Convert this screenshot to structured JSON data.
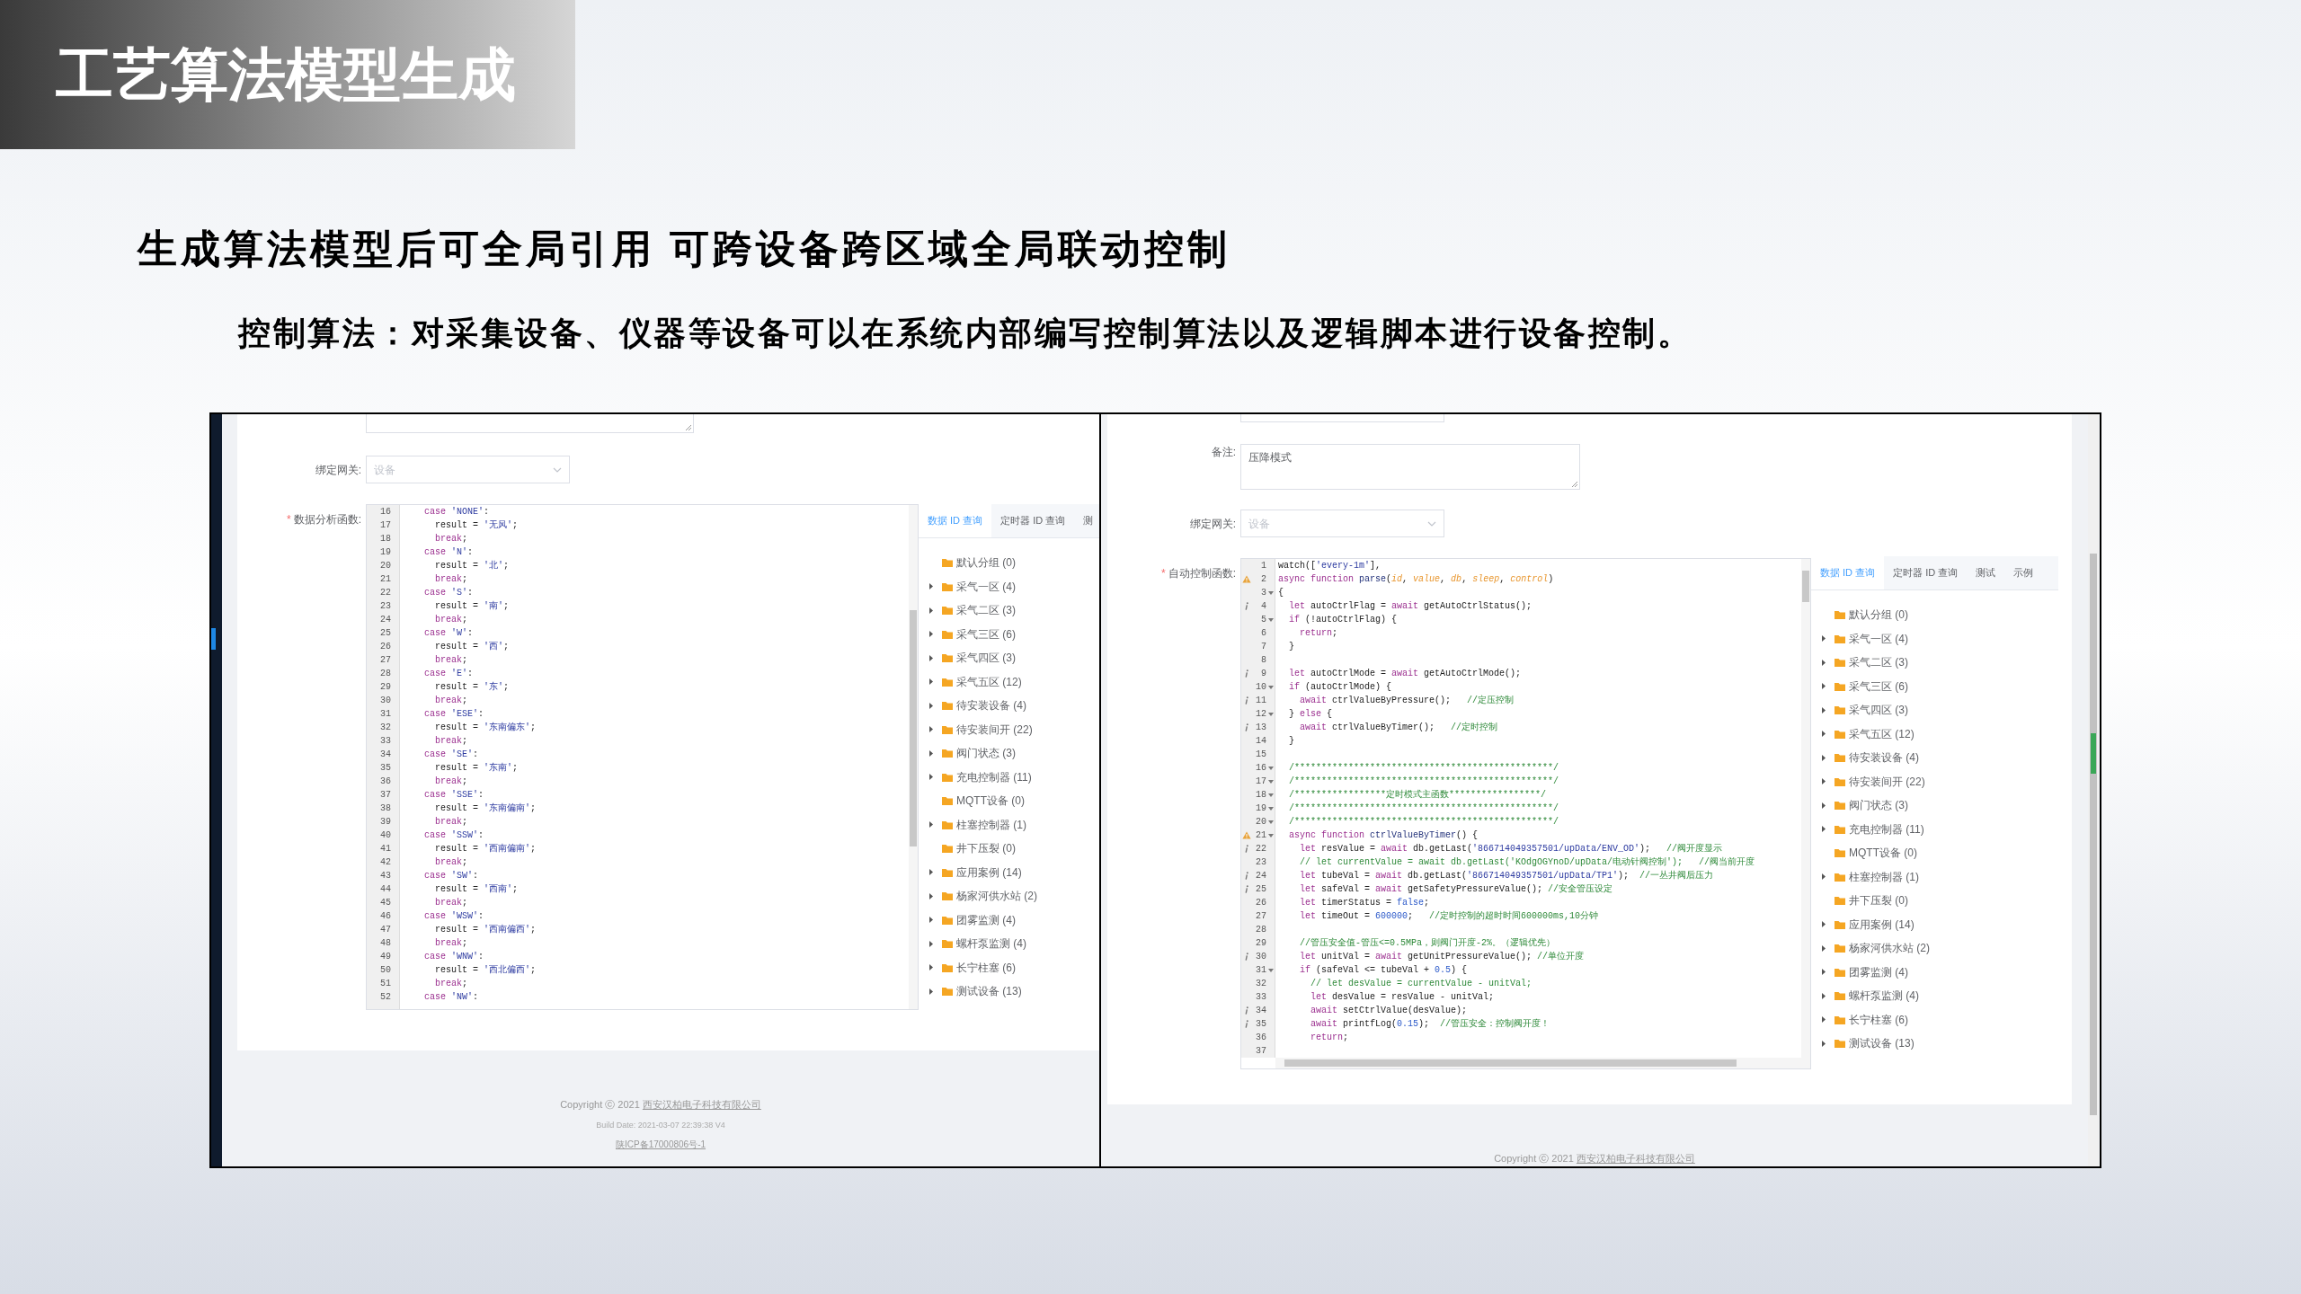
{
  "slide": {
    "title": "工艺算法模型生成",
    "subtitle": "生成算法模型后可全局引用 可跨设备跨区域全局联动控制",
    "description": "控制算法：对采集设备、仪器等设备可以在系统内部编写控制算法以及逻辑脚本进行设备控制。"
  },
  "screens": [
    {
      "fields": [
        {
          "kind": "stub_textarea"
        },
        {
          "kind": "select",
          "label": "绑定网关:",
          "placeholder": "设备"
        }
      ],
      "code_label": "数据分析函数:",
      "required_mark": "*",
      "code_lines": [
        {
          "n": "16",
          "t": [
            {
              "kind": "k",
              "text": "    case "
            },
            {
              "kind": "s",
              "text": "'NONE'"
            },
            {
              "kind": "p",
              "text": ":"
            }
          ]
        },
        {
          "n": "17",
          "t": [
            {
              "kind": "p",
              "text": "      result = "
            },
            {
              "kind": "s",
              "text": "'无风'"
            },
            {
              "kind": "p",
              "text": ";"
            }
          ]
        },
        {
          "n": "18",
          "t": [
            {
              "kind": "k",
              "text": "      break"
            },
            {
              "kind": "p",
              "text": ";"
            }
          ]
        },
        {
          "n": "19",
          "t": [
            {
              "kind": "k",
              "text": "    case "
            },
            {
              "kind": "s",
              "text": "'N'"
            },
            {
              "kind": "p",
              "text": ":"
            }
          ]
        },
        {
          "n": "20",
          "t": [
            {
              "kind": "p",
              "text": "      result = "
            },
            {
              "kind": "s",
              "text": "'北'"
            },
            {
              "kind": "p",
              "text": ";"
            }
          ]
        },
        {
          "n": "21",
          "t": [
            {
              "kind": "k",
              "text": "      break"
            },
            {
              "kind": "p",
              "text": ";"
            }
          ]
        },
        {
          "n": "22",
          "t": [
            {
              "kind": "k",
              "text": "    case "
            },
            {
              "kind": "s",
              "text": "'S'"
            },
            {
              "kind": "p",
              "text": ":"
            }
          ]
        },
        {
          "n": "23",
          "t": [
            {
              "kind": "p",
              "text": "      result = "
            },
            {
              "kind": "s",
              "text": "'南'"
            },
            {
              "kind": "p",
              "text": ";"
            }
          ]
        },
        {
          "n": "24",
          "t": [
            {
              "kind": "k",
              "text": "      break"
            },
            {
              "kind": "p",
              "text": ";"
            }
          ]
        },
        {
          "n": "25",
          "t": [
            {
              "kind": "k",
              "text": "    case "
            },
            {
              "kind": "s",
              "text": "'W'"
            },
            {
              "kind": "p",
              "text": ":"
            }
          ]
        },
        {
          "n": "26",
          "t": [
            {
              "kind": "p",
              "text": "      result = "
            },
            {
              "kind": "s",
              "text": "'西'"
            },
            {
              "kind": "p",
              "text": ";"
            }
          ]
        },
        {
          "n": "27",
          "t": [
            {
              "kind": "k",
              "text": "      break"
            },
            {
              "kind": "p",
              "text": ";"
            }
          ]
        },
        {
          "n": "28",
          "t": [
            {
              "kind": "k",
              "text": "    case "
            },
            {
              "kind": "s",
              "text": "'E'"
            },
            {
              "kind": "p",
              "text": ":"
            }
          ]
        },
        {
          "n": "29",
          "t": [
            {
              "kind": "p",
              "text": "      result = "
            },
            {
              "kind": "s",
              "text": "'东'"
            },
            {
              "kind": "p",
              "text": ";"
            }
          ]
        },
        {
          "n": "30",
          "t": [
            {
              "kind": "k",
              "text": "      break"
            },
            {
              "kind": "p",
              "text": ";"
            }
          ]
        },
        {
          "n": "31",
          "t": [
            {
              "kind": "k",
              "text": "    case "
            },
            {
              "kind": "s",
              "text": "'ESE'"
            },
            {
              "kind": "p",
              "text": ":"
            }
          ]
        },
        {
          "n": "32",
          "t": [
            {
              "kind": "p",
              "text": "      result = "
            },
            {
              "kind": "s",
              "text": "'东南偏东'"
            },
            {
              "kind": "p",
              "text": ";"
            }
          ]
        },
        {
          "n": "33",
          "t": [
            {
              "kind": "k",
              "text": "      break"
            },
            {
              "kind": "p",
              "text": ";"
            }
          ]
        },
        {
          "n": "34",
          "t": [
            {
              "kind": "k",
              "text": "    case "
            },
            {
              "kind": "s",
              "text": "'SE'"
            },
            {
              "kind": "p",
              "text": ":"
            }
          ]
        },
        {
          "n": "35",
          "t": [
            {
              "kind": "p",
              "text": "      result = "
            },
            {
              "kind": "s",
              "text": "'东南'"
            },
            {
              "kind": "p",
              "text": ";"
            }
          ]
        },
        {
          "n": "36",
          "t": [
            {
              "kind": "k",
              "text": "      break"
            },
            {
              "kind": "p",
              "text": ";"
            }
          ]
        },
        {
          "n": "37",
          "t": [
            {
              "kind": "k",
              "text": "    case "
            },
            {
              "kind": "s",
              "text": "'SSE'"
            },
            {
              "kind": "p",
              "text": ":"
            }
          ]
        },
        {
          "n": "38",
          "t": [
            {
              "kind": "p",
              "text": "      result = "
            },
            {
              "kind": "s",
              "text": "'东南偏南'"
            },
            {
              "kind": "p",
              "text": ";"
            }
          ]
        },
        {
          "n": "39",
          "t": [
            {
              "kind": "k",
              "text": "      break"
            },
            {
              "kind": "p",
              "text": ";"
            }
          ]
        },
        {
          "n": "40",
          "t": [
            {
              "kind": "k",
              "text": "    case "
            },
            {
              "kind": "s",
              "text": "'SSW'"
            },
            {
              "kind": "p",
              "text": ":"
            }
          ]
        },
        {
          "n": "41",
          "t": [
            {
              "kind": "p",
              "text": "      result = "
            },
            {
              "kind": "s",
              "text": "'西南偏南'"
            },
            {
              "kind": "p",
              "text": ";"
            }
          ]
        },
        {
          "n": "42",
          "t": [
            {
              "kind": "k",
              "text": "      break"
            },
            {
              "kind": "p",
              "text": ";"
            }
          ]
        },
        {
          "n": "43",
          "t": [
            {
              "kind": "k",
              "text": "    case "
            },
            {
              "kind": "s",
              "text": "'SW'"
            },
            {
              "kind": "p",
              "text": ":"
            }
          ]
        },
        {
          "n": "44",
          "t": [
            {
              "kind": "p",
              "text": "      result = "
            },
            {
              "kind": "s",
              "text": "'西南'"
            },
            {
              "kind": "p",
              "text": ";"
            }
          ]
        },
        {
          "n": "45",
          "t": [
            {
              "kind": "k",
              "text": "      break"
            },
            {
              "kind": "p",
              "text": ";"
            }
          ]
        },
        {
          "n": "46",
          "t": [
            {
              "kind": "k",
              "text": "    case "
            },
            {
              "kind": "s",
              "text": "'WSW'"
            },
            {
              "kind": "p",
              "text": ":"
            }
          ]
        },
        {
          "n": "47",
          "t": [
            {
              "kind": "p",
              "text": "      result = "
            },
            {
              "kind": "s",
              "text": "'西南偏西'"
            },
            {
              "kind": "p",
              "text": ";"
            }
          ]
        },
        {
          "n": "48",
          "t": [
            {
              "kind": "k",
              "text": "      break"
            },
            {
              "kind": "p",
              "text": ";"
            }
          ]
        },
        {
          "n": "49",
          "t": [
            {
              "kind": "k",
              "text": "    case "
            },
            {
              "kind": "s",
              "text": "'WNW'"
            },
            {
              "kind": "p",
              "text": ":"
            }
          ]
        },
        {
          "n": "50",
          "t": [
            {
              "kind": "p",
              "text": "      result = "
            },
            {
              "kind": "s",
              "text": "'西北偏西'"
            },
            {
              "kind": "p",
              "text": ";"
            }
          ]
        },
        {
          "n": "51",
          "t": [
            {
              "kind": "k",
              "text": "      break"
            },
            {
              "kind": "p",
              "text": ";"
            }
          ]
        },
        {
          "n": "52",
          "t": [
            {
              "kind": "k",
              "text": "    case "
            },
            {
              "kind": "s",
              "text": "'NW'"
            },
            {
              "kind": "p",
              "text": ":"
            }
          ]
        }
      ],
      "tree_tabs": [
        {
          "label": "数据 ID 查询",
          "selected": true
        },
        {
          "label": "定时器 ID 查询",
          "selected": false
        },
        {
          "label": "测",
          "selected": false
        }
      ],
      "tree_items": [
        {
          "label": "默认分组 (0)",
          "expandable": false
        },
        {
          "label": "采气一区 (4)",
          "expandable": true
        },
        {
          "label": "采气二区 (3)",
          "expandable": true
        },
        {
          "label": "采气三区 (6)",
          "expandable": true
        },
        {
          "label": "采气四区 (3)",
          "expandable": true
        },
        {
          "label": "采气五区 (12)",
          "expandable": true
        },
        {
          "label": "待安装设备 (4)",
          "expandable": true
        },
        {
          "label": "待安装间开 (22)",
          "expandable": true
        },
        {
          "label": "阀门状态 (3)",
          "expandable": true
        },
        {
          "label": "充电控制器 (11)",
          "expandable": true
        },
        {
          "label": "MQTT设备 (0)",
          "expandable": false
        },
        {
          "label": "柱塞控制器 (1)",
          "expandable": true
        },
        {
          "label": "井下压裂 (0)",
          "expandable": false
        },
        {
          "label": "应用案例 (14)",
          "expandable": true
        },
        {
          "label": "杨家河供水站 (2)",
          "expandable": true
        },
        {
          "label": "团雾监测 (4)",
          "expandable": true
        },
        {
          "label": "螺杆泵监测 (4)",
          "expandable": true
        },
        {
          "label": "长宁柱塞 (6)",
          "expandable": true
        },
        {
          "label": "测试设备 (13)",
          "expandable": true
        }
      ],
      "footer": {
        "copyright": "Copyright ⓒ 2021",
        "company": "西安汉柏电子科技有限公司",
        "build": "Build Date: 2021-03-07 22:39:38 V4",
        "icp": "陕ICP备17000806号-1"
      }
    },
    {
      "fields": [
        {
          "kind": "stub_input"
        },
        {
          "kind": "textarea",
          "label": "备注:",
          "value": "压降模式"
        },
        {
          "kind": "select",
          "label": "绑定网关:",
          "placeholder": "设备"
        }
      ],
      "code_label": "自动控制函数:",
      "required_mark": "*",
      "code_lines": [
        {
          "n": "1",
          "fold": false,
          "t": [
            {
              "kind": "p",
              "text": "watch(["
            },
            {
              "kind": "s",
              "text": "'every-1m'"
            },
            {
              "kind": "p",
              "text": "],"
            }
          ]
        },
        {
          "n": "2",
          "fold": false,
          "kind": "warn",
          "t": [
            {
              "kind": "k",
              "text": "async function "
            },
            {
              "kind": "d",
              "text": "parse"
            },
            {
              "kind": "p",
              "text": "("
            },
            {
              "kind": "v",
              "text": "id"
            },
            {
              "kind": "p",
              "text": ", "
            },
            {
              "kind": "v",
              "text": "value"
            },
            {
              "kind": "p",
              "text": ", "
            },
            {
              "kind": "v",
              "text": "db"
            },
            {
              "kind": "p",
              "text": ", "
            },
            {
              "kind": "v",
              "text": "sleep"
            },
            {
              "kind": "p",
              "text": ", "
            },
            {
              "kind": "v",
              "text": "control"
            },
            {
              "kind": "p",
              "text": ")"
            }
          ]
        },
        {
          "n": "3",
          "fold": true,
          "t": [
            {
              "kind": "p",
              "text": "{"
            }
          ]
        },
        {
          "n": "4",
          "fold": false,
          "kind": "info",
          "t": [
            {
              "kind": "k",
              "text": "  let "
            },
            {
              "kind": "p",
              "text": "autoCtrlFlag = "
            },
            {
              "kind": "k",
              "text": "await "
            },
            {
              "kind": "p",
              "text": "getAutoCtrlStatus();"
            }
          ]
        },
        {
          "n": "5",
          "fold": true,
          "t": [
            {
              "kind": "k",
              "text": "  if "
            },
            {
              "kind": "p",
              "text": "(!autoCtrlFlag) {"
            }
          ]
        },
        {
          "n": "6",
          "fold": false,
          "t": [
            {
              "kind": "k",
              "text": "    return"
            },
            {
              "kind": "p",
              "text": ";"
            }
          ]
        },
        {
          "n": "7",
          "fold": false,
          "t": [
            {
              "kind": "p",
              "text": "  }"
            }
          ]
        },
        {
          "n": "8",
          "fold": false
        },
        {
          "n": "9",
          "fold": false,
          "kind": "info",
          "t": [
            {
              "kind": "k",
              "text": "  let "
            },
            {
              "kind": "p",
              "text": "autoCtrlMode = "
            },
            {
              "kind": "k",
              "text": "await "
            },
            {
              "kind": "p",
              "text": "getAutoCtrlMode();"
            }
          ]
        },
        {
          "n": "10",
          "fold": true,
          "t": [
            {
              "kind": "k",
              "text": "  if "
            },
            {
              "kind": "p",
              "text": "(autoCtrlMode) {"
            }
          ]
        },
        {
          "n": "11",
          "fold": false,
          "kind": "info",
          "t": [
            {
              "kind": "k",
              "text": "    await "
            },
            {
              "kind": "p",
              "text": "ctrlValueByPressure();   "
            },
            {
              "kind": "c",
              "text": "//定压控制"
            }
          ]
        },
        {
          "n": "12",
          "fold": true,
          "t": [
            {
              "kind": "p",
              "text": "  } "
            },
            {
              "kind": "k",
              "text": "else "
            },
            {
              "kind": "p",
              "text": "{"
            }
          ]
        },
        {
          "n": "13",
          "fold": false,
          "kind": "info",
          "t": [
            {
              "kind": "k",
              "text": "    await "
            },
            {
              "kind": "p",
              "text": "ctrlValueByTimer();   "
            },
            {
              "kind": "c",
              "text": "//定时控制"
            }
          ]
        },
        {
          "n": "14",
          "fold": false,
          "t": [
            {
              "kind": "p",
              "text": "  }"
            }
          ]
        },
        {
          "n": "15",
          "fold": false
        },
        {
          "n": "16",
          "fold": true,
          "t": [
            {
              "kind": "c",
              "text": "  /************************************************/"
            }
          ]
        },
        {
          "n": "17",
          "fold": true,
          "t": [
            {
              "kind": "c",
              "text": "  /************************************************/"
            }
          ]
        },
        {
          "n": "18",
          "fold": true,
          "t": [
            {
              "kind": "c",
              "text": "  /*****************定时模式主函数*****************/"
            }
          ]
        },
        {
          "n": "19",
          "fold": true,
          "t": [
            {
              "kind": "c",
              "text": "  /************************************************/"
            }
          ]
        },
        {
          "n": "20",
          "fold": true,
          "t": [
            {
              "kind": "c",
              "text": "  /************************************************/"
            }
          ]
        },
        {
          "n": "21",
          "fold": true,
          "kind": "warn",
          "t": [
            {
              "kind": "k",
              "text": "  async function "
            },
            {
              "kind": "d",
              "text": "ctrlValueByTimer"
            },
            {
              "kind": "p",
              "text": "() {"
            }
          ]
        },
        {
          "n": "22",
          "fold": false,
          "kind": "info",
          "t": [
            {
              "kind": "k",
              "text": "    let "
            },
            {
              "kind": "p",
              "text": "resValue = "
            },
            {
              "kind": "k",
              "text": "await "
            },
            {
              "kind": "p",
              "text": "db.getLast("
            },
            {
              "kind": "s",
              "text": "'866714049357501/upData/ENV_OD'"
            },
            {
              "kind": "p",
              "text": ");   "
            },
            {
              "kind": "c",
              "text": "//阀开度显示"
            }
          ]
        },
        {
          "n": "23",
          "fold": false,
          "t": [
            {
              "kind": "c",
              "text": "    // let currentValue = await db.getLast('KOdgOGYnoD/upData/电动针阀控制');   //阀当前开度"
            }
          ]
        },
        {
          "n": "24",
          "fold": false,
          "kind": "info",
          "t": [
            {
              "kind": "k",
              "text": "    let "
            },
            {
              "kind": "p",
              "text": "tubeVal = "
            },
            {
              "kind": "k",
              "text": "await "
            },
            {
              "kind": "p",
              "text": "db.getLast("
            },
            {
              "kind": "s",
              "text": "'866714049357501/upData/TP1'"
            },
            {
              "kind": "p",
              "text": ");  "
            },
            {
              "kind": "c",
              "text": "//一丛井阀后压力"
            }
          ]
        },
        {
          "n": "25",
          "fold": false,
          "kind": "info",
          "t": [
            {
              "kind": "k",
              "text": "    let "
            },
            {
              "kind": "p",
              "text": "safeVal = "
            },
            {
              "kind": "k",
              "text": "await "
            },
            {
              "kind": "p",
              "text": "getSafetyPressureValue(); "
            },
            {
              "kind": "c",
              "text": "//安全管压设定"
            }
          ]
        },
        {
          "n": "26",
          "fold": false,
          "t": [
            {
              "kind": "k",
              "text": "    let "
            },
            {
              "kind": "p",
              "text": "timerStatus = "
            },
            {
              "kind": "n",
              "text": "false"
            },
            {
              "kind": "p",
              "text": ";"
            }
          ]
        },
        {
          "n": "27",
          "fold": false,
          "t": [
            {
              "kind": "k",
              "text": "    let "
            },
            {
              "kind": "p",
              "text": "timeOut = "
            },
            {
              "kind": "n",
              "text": "600000"
            },
            {
              "kind": "p",
              "text": ";   "
            },
            {
              "kind": "c",
              "text": "//定时控制的超时时间600000ms,10分钟"
            }
          ]
        },
        {
          "n": "28",
          "fold": false
        },
        {
          "n": "29",
          "fold": false,
          "t": [
            {
              "kind": "c",
              "text": "    //管压安全值-管压<=0.5MPa，则阀门开度-2%。（逻辑优先）"
            }
          ]
        },
        {
          "n": "30",
          "fold": false,
          "kind": "info",
          "t": [
            {
              "kind": "k",
              "text": "    let "
            },
            {
              "kind": "p",
              "text": "unitVal = "
            },
            {
              "kind": "k",
              "text": "await "
            },
            {
              "kind": "p",
              "text": "getUnitPressureValue(); "
            },
            {
              "kind": "c",
              "text": "//单位开度"
            }
          ]
        },
        {
          "n": "31",
          "fold": true,
          "t": [
            {
              "kind": "k",
              "text": "    if "
            },
            {
              "kind": "p",
              "text": "(safeVal <= tubeVal + "
            },
            {
              "kind": "n",
              "text": "0.5"
            },
            {
              "kind": "p",
              "text": ") {"
            }
          ]
        },
        {
          "n": "32",
          "fold": false,
          "t": [
            {
              "kind": "c",
              "text": "      // let desValue = currentValue - unitVal;"
            }
          ]
        },
        {
          "n": "33",
          "fold": false,
          "t": [
            {
              "kind": "k",
              "text": "      let "
            },
            {
              "kind": "p",
              "text": "desValue = resValue - unitVal;"
            }
          ]
        },
        {
          "n": "34",
          "fold": false,
          "kind": "info",
          "t": [
            {
              "kind": "k",
              "text": "      await "
            },
            {
              "kind": "p",
              "text": "setCtrlValue(desValue);"
            }
          ]
        },
        {
          "n": "35",
          "fold": false,
          "kind": "info",
          "t": [
            {
              "kind": "k",
              "text": "      await "
            },
            {
              "kind": "p",
              "text": "printfLog("
            },
            {
              "kind": "n",
              "text": "0.15"
            },
            {
              "kind": "p",
              "text": ");  "
            },
            {
              "kind": "c",
              "text": "//管压安全：控制阀开度！"
            }
          ]
        },
        {
          "n": "36",
          "fold": false,
          "t": [
            {
              "kind": "k",
              "text": "      return"
            },
            {
              "kind": "p",
              "text": ";"
            }
          ]
        },
        {
          "n": "37",
          "fold": false
        }
      ],
      "tree_tabs": [
        {
          "label": "数据 ID 查询",
          "selected": true
        },
        {
          "label": "定时器 ID 查询",
          "selected": false
        },
        {
          "label": "测试",
          "selected": false
        },
        {
          "label": "示例",
          "selected": false
        }
      ],
      "tree_items": [
        {
          "label": "默认分组 (0)",
          "expandable": false
        },
        {
          "label": "采气一区 (4)",
          "expandable": true
        },
        {
          "label": "采气二区 (3)",
          "expandable": true
        },
        {
          "label": "采气三区 (6)",
          "expandable": true
        },
        {
          "label": "采气四区 (3)",
          "expandable": true
        },
        {
          "label": "采气五区 (12)",
          "expandable": true
        },
        {
          "label": "待安装设备 (4)",
          "expandable": true
        },
        {
          "label": "待安装间开 (22)",
          "expandable": true
        },
        {
          "label": "阀门状态 (3)",
          "expandable": true
        },
        {
          "label": "充电控制器 (11)",
          "expandable": true
        },
        {
          "label": "MQTT设备 (0)",
          "expandable": false
        },
        {
          "label": "柱塞控制器 (1)",
          "expandable": true
        },
        {
          "label": "井下压裂 (0)",
          "expandable": false
        },
        {
          "label": "应用案例 (14)",
          "expandable": true
        },
        {
          "label": "杨家河供水站 (2)",
          "expandable": true
        },
        {
          "label": "团雾监测 (4)",
          "expandable": true
        },
        {
          "label": "螺杆泵监测 (4)",
          "expandable": true
        },
        {
          "label": "长宁柱塞 (6)",
          "expandable": true
        },
        {
          "label": "测试设备 (13)",
          "expandable": true
        }
      ],
      "footer": {
        "copyright": "Copyright ⓒ 2021",
        "company": "西安汉柏电子科技有限公司"
      }
    }
  ]
}
